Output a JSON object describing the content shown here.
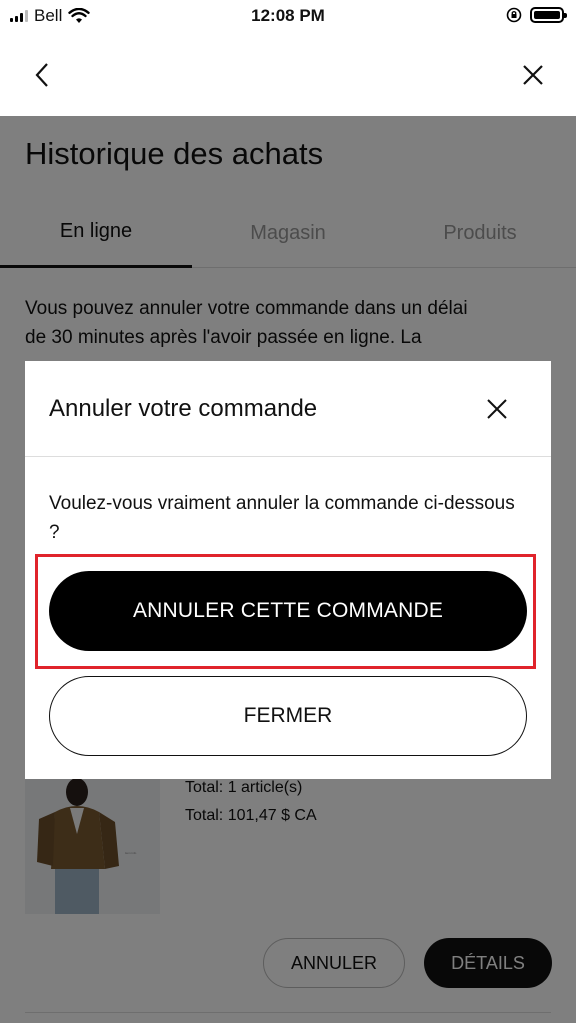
{
  "status_bar": {
    "carrier": "Bell",
    "time": "12:08 PM"
  },
  "nav": {
    "back_icon": "chevron-left-icon",
    "close_icon": "close-icon"
  },
  "page": {
    "title": "Historique des achats",
    "tabs": [
      {
        "label": "En ligne",
        "active": true
      },
      {
        "label": "Magasin",
        "active": false
      },
      {
        "label": "Produits",
        "active": false
      }
    ],
    "intro_line1": "Vous pouvez annuler votre commande dans un délai",
    "intro_line2": "de 30 minutes après l'avoir passée en ligne. La",
    "order": {
      "total_items": "Total: 1 article(s)",
      "total_price": "Total: 101,47 $ CA"
    },
    "cancel_button": "ANNULER",
    "details_button": "DÉTAILS"
  },
  "modal": {
    "title": "Annuler votre commande",
    "message": "Voulez-vous vraiment annuler la commande ci-dessous ?",
    "confirm_button": "ANNULER CETTE COMMANDE",
    "close_button": "FERMER"
  },
  "colors": {
    "highlight": "#e0232b",
    "primary": "#000000"
  }
}
